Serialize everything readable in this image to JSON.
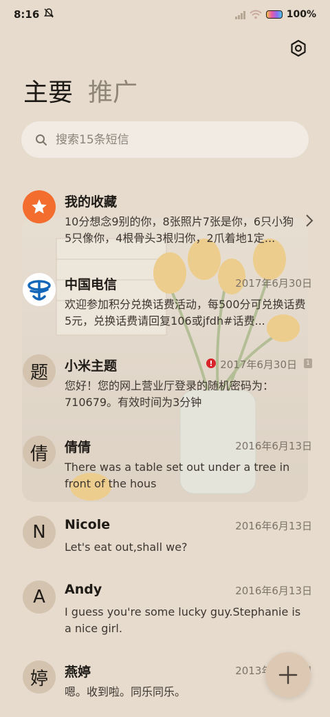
{
  "status": {
    "time": "8:16",
    "battery_pct": "100%"
  },
  "tabs": {
    "primary": "主要",
    "promo": "推广"
  },
  "search": {
    "placeholder": "搜索15条短信"
  },
  "conversations": [
    {
      "name": "我的收藏",
      "avatar": "",
      "date": "",
      "preview": "10分想念9别的你，8张照片7张是你，6只小狗5只像你，4根骨头3根归你，2爪着地1定..."
    },
    {
      "name": "中国电信",
      "avatar": "",
      "date": "2017年6月30日",
      "preview": "欢迎参加积分兑换话费活动，每500分可兑换话费5元，兑换话费请回复106或jfdh#话费..."
    },
    {
      "name": "小米主题",
      "avatar": "题",
      "date": "2017年6月30日",
      "error": "!",
      "sim": "1",
      "preview": "您好！您的网上营业厅登录的随机密码为：710679。有效时间为3分钟"
    },
    {
      "name": "倩倩",
      "avatar": "倩",
      "date": "2016年6月13日",
      "preview": "There was a table set out under a tree in front of the hous"
    },
    {
      "name": "Nicole",
      "avatar": "N",
      "date": "2016年6月13日",
      "preview": "Let's eat out,shall we?"
    },
    {
      "name": "Andy",
      "avatar": "A",
      "date": "2016年6月13日",
      "preview": "I guess you're some lucky guy.Stephanie is a nice girl."
    },
    {
      "name": "燕婷",
      "avatar": "婷",
      "date": "2013年6月13日",
      "preview": "嗯。收到啦。同乐同乐。"
    }
  ],
  "icons": {
    "settings": "settings-icon",
    "search": "search-icon",
    "compose": "plus-icon",
    "favorite": "star-icon",
    "telecom": "china-telecom-logo"
  },
  "colors": {
    "background": "#e6dbcd",
    "favorite_accent": "#f26d2e",
    "error": "#d8252c",
    "telecom_blue": "#1466b8"
  }
}
